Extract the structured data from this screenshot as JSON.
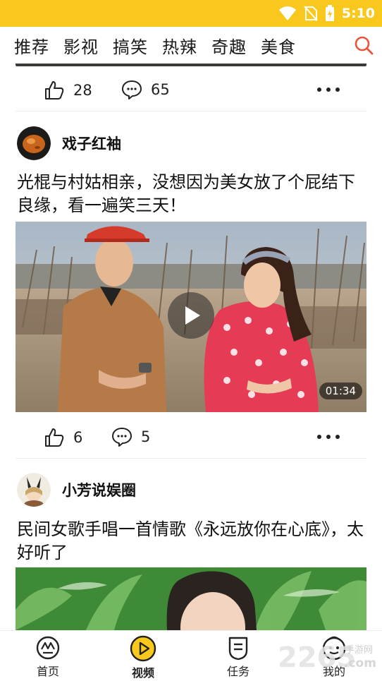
{
  "status": {
    "time": "5:10"
  },
  "top_tabs": [
    "推荐",
    "影视",
    "搞笑",
    "热辣",
    "奇趣",
    "美食"
  ],
  "post0": {
    "likes": "28",
    "comments": "65"
  },
  "post1": {
    "author": "戏子红袖",
    "title": "光棍与村姑相亲，没想因为美女放了个屁结下良缘，看一遍笑三天！",
    "duration": "01:34",
    "likes": "6",
    "comments": "5"
  },
  "post2": {
    "author": "小芳说娱圈",
    "title": "民间女歌手唱一首情歌《永远放你在心底》，太好听了"
  },
  "bottom_nav": [
    {
      "label": "首页",
      "icon": "home-icon"
    },
    {
      "label": "视频",
      "icon": "video-play-icon"
    },
    {
      "label": "任务",
      "icon": "task-icon"
    },
    {
      "label": "我的",
      "icon": "profile-icon"
    }
  ],
  "watermark": {
    "text": "2265",
    "sub": "手游网",
    "domain": ".com"
  },
  "colors": {
    "accent": "#f8c81d",
    "search": "#e8553b"
  }
}
